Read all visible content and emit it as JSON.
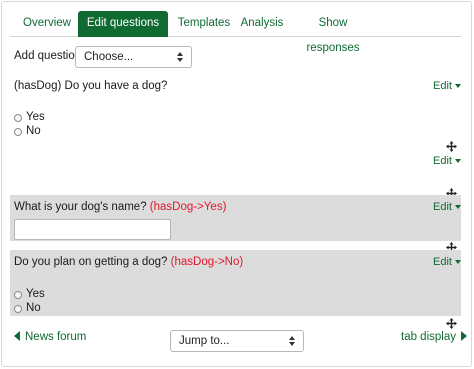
{
  "tabs": [
    {
      "label": "Overview",
      "active": false
    },
    {
      "label": "Edit questions",
      "active": true
    },
    {
      "label": "Templates",
      "active": false
    },
    {
      "label": "Analysis",
      "active": false
    },
    {
      "label": "Show responses",
      "active": false
    }
  ],
  "add_question": {
    "label": "Add question",
    "selected": "Choose..."
  },
  "questions": [
    {
      "tag": "(hasDog)",
      "text": "Do you have a dog?",
      "edit_label": "Edit",
      "options": [
        "Yes",
        "No"
      ]
    },
    {
      "text": "What is your dog's name?",
      "tag": "(hasDog->Yes)",
      "edit_label": "Edit"
    },
    {
      "text": "Do you plan on getting a dog?",
      "tag": "(hasDog->No)",
      "edit_label": "Edit",
      "options": [
        "Yes",
        "No"
      ]
    }
  ],
  "page_break": {
    "edit_label": "Edit"
  },
  "footer": {
    "prev_link": "News forum",
    "jump_selected": "Jump to...",
    "next_link": "tab display"
  },
  "colors": {
    "accent": "#0f6b32",
    "tag": "#e0182d",
    "block_bg": "#dcdcdc"
  },
  "icons": {
    "move": "move-icon",
    "caret": "caret-down-icon"
  }
}
